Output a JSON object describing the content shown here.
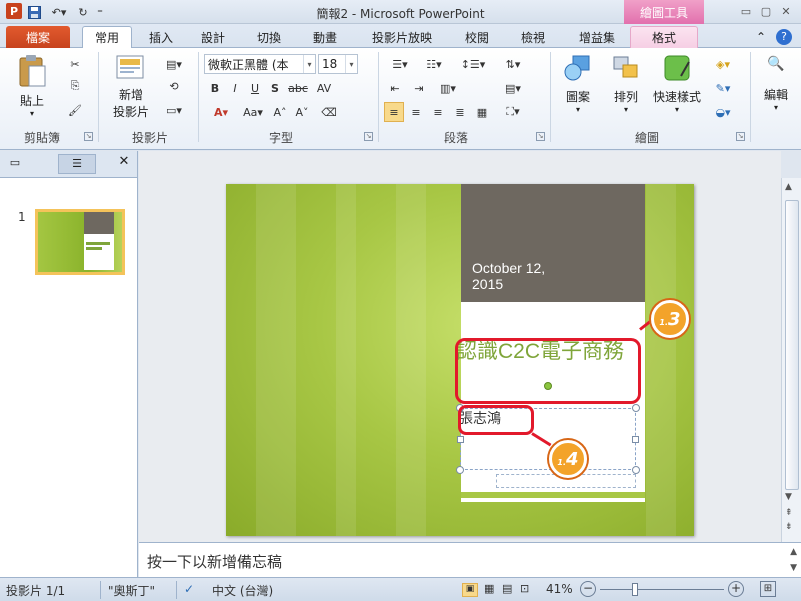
{
  "window": {
    "title": "簡報2 - Microsoft PowerPoint",
    "context_tab_header": "繪圖工具",
    "controls": [
      "▭",
      "▢",
      "✕"
    ]
  },
  "tabs": [
    {
      "label": "檔案"
    },
    {
      "label": "常用"
    },
    {
      "label": "插入"
    },
    {
      "label": "設計"
    },
    {
      "label": "切換"
    },
    {
      "label": "動畫"
    },
    {
      "label": "投影片放映"
    },
    {
      "label": "校閱"
    },
    {
      "label": "檢視"
    },
    {
      "label": "增益集"
    },
    {
      "label": "格式"
    }
  ],
  "ribbon": {
    "clipboard": {
      "paste": "貼上",
      "group": "剪貼簿"
    },
    "slides": {
      "new_slide_1": "新增",
      "new_slide_2": "投影片",
      "group": "投影片"
    },
    "font": {
      "font_name": "微軟正黑體 (本",
      "font_size": "18",
      "group": "字型"
    },
    "paragraph": {
      "group": "段落"
    },
    "drawing": {
      "shapes": "圖案",
      "arrange": "排列",
      "quick_styles": "快速樣式",
      "group": "繪圖"
    },
    "editing": {
      "label": "編輯"
    }
  },
  "slide_panel": {
    "thumb_number": "1"
  },
  "slide": {
    "date": "October 12,\n2015",
    "title": "認識C2C電子商務",
    "subtitle": "張志鴻"
  },
  "callouts": {
    "step3": "3",
    "step3_prefix": "1.",
    "step4": "4",
    "step4_prefix": "1."
  },
  "notes": {
    "placeholder": "按一下以新增備忘稿"
  },
  "status": {
    "slide_info": "投影片 1/1",
    "theme": "\"奧斯丁\"",
    "language": "中文 (台灣)",
    "zoom": "41%"
  },
  "colors": {
    "accent_green": "#7fa53a",
    "card_dark": "#6e6860",
    "callout_red": "#e2192b",
    "callout_orange": "#f3a32a"
  }
}
